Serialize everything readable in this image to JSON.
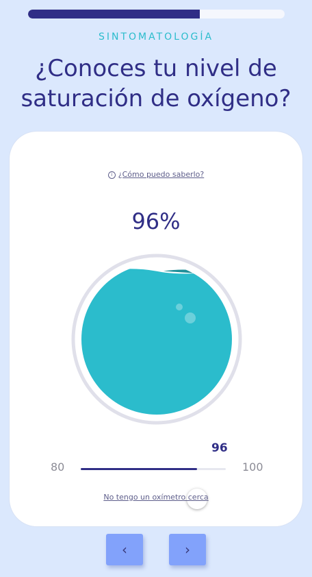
{
  "progress": {
    "fraction": 0.67
  },
  "header": {
    "section": "SINTOMATOLOGÍA",
    "title_line1": "¿Conoces tu nivel de",
    "title_line2": "saturación de oxígeno?"
  },
  "card": {
    "help_link": "¿Cómo puedo saberlo?",
    "percent_label": "96%",
    "gauge": {
      "level": 0.96,
      "fill_color": "#2bbccc",
      "ring_color": "#e0e0ea"
    },
    "slider": {
      "min": "80",
      "max": "100",
      "value": "96",
      "value_num": 96,
      "min_num": 80,
      "max_num": 100
    },
    "no_oximeter_link": "No tengo un oxímetro cerca"
  },
  "nav": {
    "prev_icon": "chevron-left-icon",
    "next_icon": "chevron-right-icon"
  },
  "colors": {
    "accent": "#302e86",
    "teal": "#2bbccc",
    "background": "#dbe8fd",
    "nav_button": "#82a2fb"
  }
}
